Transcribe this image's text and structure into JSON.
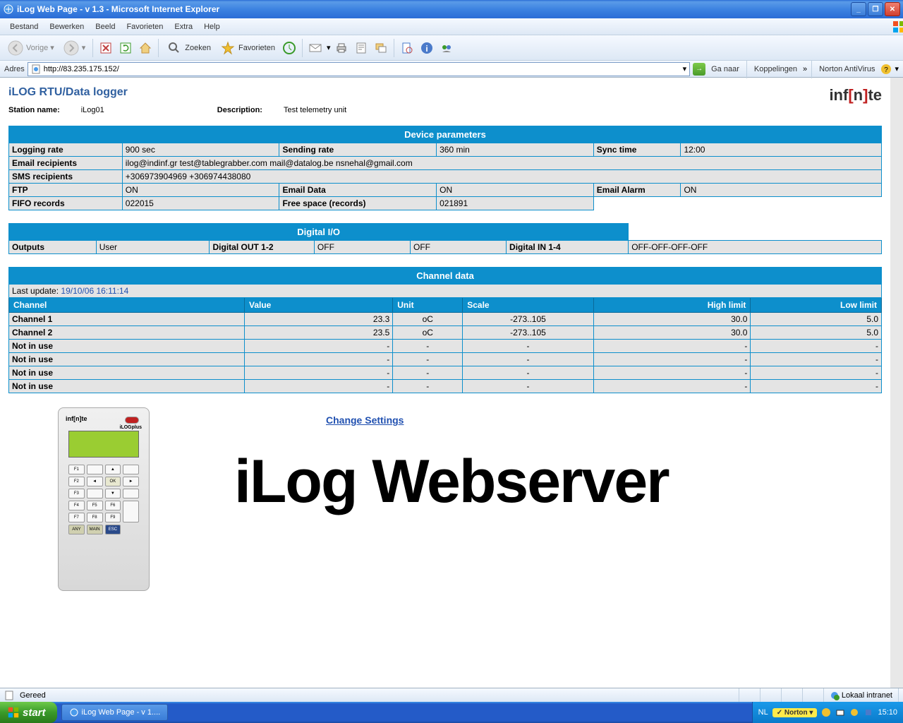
{
  "window": {
    "title": "iLog Web Page - v 1.3 - Microsoft Internet Explorer"
  },
  "menu": [
    "Bestand",
    "Bewerken",
    "Beeld",
    "Favorieten",
    "Extra",
    "Help"
  ],
  "toolbar": {
    "back": "Vorige",
    "search": "Zoeken",
    "favorites": "Favorieten"
  },
  "address": {
    "label": "Adres",
    "url": "http://83.235.175.152/",
    "go": "Ga naar",
    "links": "Koppelingen",
    "norton": "Norton AntiVirus"
  },
  "page": {
    "title": "iLOG RTU/Data logger",
    "station_label": "Station name:",
    "station_value": "iLog01",
    "desc_label": "Description:",
    "desc_value": "Test telemetry unit",
    "sections": {
      "device": "Device parameters",
      "digital": "Digital I/O",
      "channel": "Channel data"
    },
    "device": {
      "logging_rate_l": "Logging rate",
      "logging_rate_v": "900 sec",
      "sending_rate_l": "Sending rate",
      "sending_rate_v": "360 min",
      "sync_l": "Sync time",
      "sync_v": "12:00",
      "email_rec_l": "Email recipients",
      "email_rec_v": "ilog@indinf.gr test@tablegrabber.com mail@datalog.be nsnehal@gmail.com",
      "sms_l": "SMS recipients",
      "sms_v": "+306973904969 +306974438080",
      "ftp_l": "FTP",
      "ftp_v": "ON",
      "email_data_l": "Email Data",
      "email_data_v": "ON",
      "email_alarm_l": "Email Alarm",
      "email_alarm_v": "ON",
      "fifo_l": "FIFO records",
      "fifo_v": "022015",
      "free_l": "Free space (records)",
      "free_v": "021891"
    },
    "digital": {
      "outputs_l": "Outputs",
      "outputs_v": "User",
      "dout_l": "Digital OUT 1-2",
      "dout_v1": "OFF",
      "dout_v2": "OFF",
      "din_l": "Digital IN 1-4",
      "din_v": "OFF-OFF-OFF-OFF"
    },
    "channel": {
      "last_update_l": "Last update:",
      "last_update_v": "19/10/06 16:11:14",
      "headers": [
        "Channel",
        "Value",
        "Unit",
        "Scale",
        "High limit",
        "Low limit"
      ],
      "rows": [
        {
          "ch": "Channel 1",
          "val": "23.3",
          "unit": "oC",
          "scale": "-273..105",
          "hi": "30.0",
          "lo": "5.0"
        },
        {
          "ch": "Channel 2",
          "val": "23.5",
          "unit": "oC",
          "scale": "-273..105",
          "hi": "30.0",
          "lo": "5.0"
        },
        {
          "ch": "Not in use",
          "val": "-",
          "unit": "-",
          "scale": "-",
          "hi": "-",
          "lo": "-"
        },
        {
          "ch": "Not in use",
          "val": "-",
          "unit": "-",
          "scale": "-",
          "hi": "-",
          "lo": "-"
        },
        {
          "ch": "Not in use",
          "val": "-",
          "unit": "-",
          "scale": "-",
          "hi": "-",
          "lo": "-"
        },
        {
          "ch": "Not in use",
          "val": "-",
          "unit": "-",
          "scale": "-",
          "hi": "-",
          "lo": "-"
        }
      ]
    },
    "change_link": "Change Settings",
    "big": "iLog Webserver"
  },
  "status": {
    "ready": "Gereed",
    "zone": "Lokaal intranet"
  },
  "taskbar": {
    "start": "start",
    "task": "iLog Web Page - v 1....",
    "lang": "NL",
    "norton": "Norton",
    "time": "15:10"
  }
}
